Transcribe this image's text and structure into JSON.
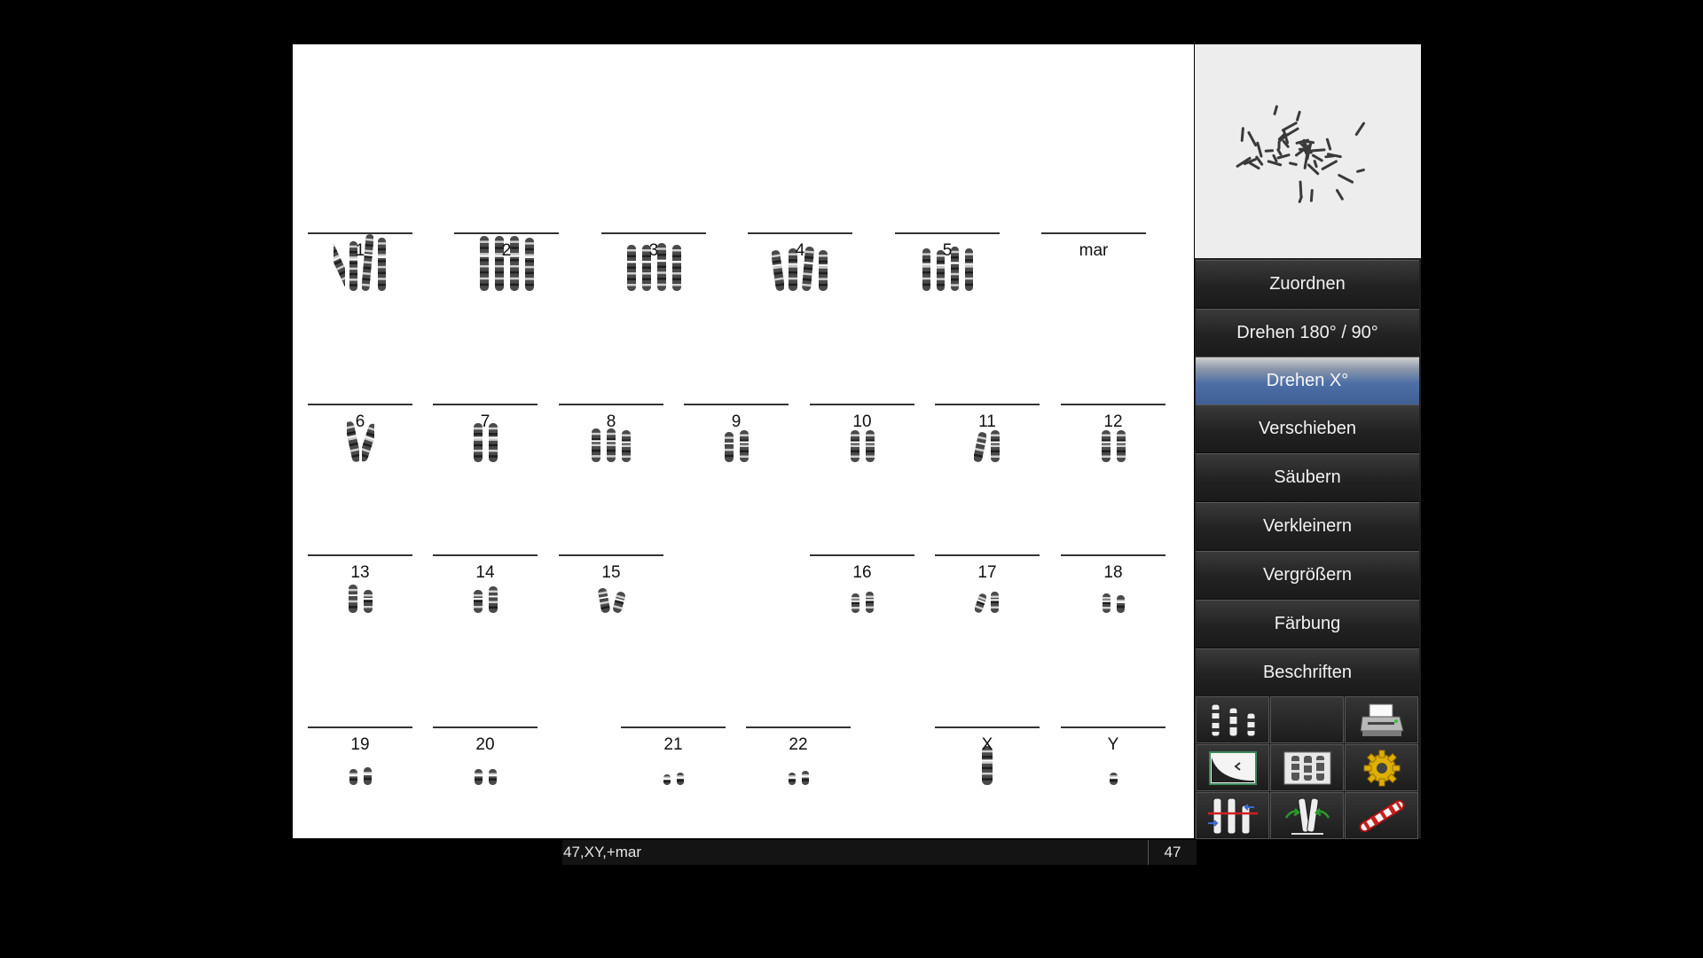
{
  "karyogram": {
    "chromosome_labels": [
      "1",
      "2",
      "3",
      "4",
      "5",
      "mar",
      "6",
      "7",
      "8",
      "9",
      "10",
      "11",
      "12",
      "13",
      "14",
      "15",
      "16",
      "17",
      "18",
      "19",
      "20",
      "21",
      "22",
      "X",
      "Y"
    ]
  },
  "status": {
    "karyotype": "47,XY,+mar",
    "chromosome_count": "47"
  },
  "menu": {
    "assign": "Zuordnen",
    "rotate_180_90": "Drehen 180° / 90°",
    "rotate_x": "Drehen X°",
    "move": "Verschieben",
    "clean": "Säubern",
    "shrink": "Verkleinern",
    "enlarge": "Vergrößern",
    "staining": "Färbung",
    "label": "Beschriften"
  },
  "toolbar": {
    "icons": [
      "karyotype-layout-icon",
      "empty-slot",
      "printer-icon",
      "image-contrast-icon",
      "chromosome-pair-icon",
      "settings-gear-icon",
      "chromosome-swap-icon",
      "chromosome-straighten-icon",
      "chromosome-brush-icon"
    ]
  },
  "colors": {
    "background": "#000000",
    "karyogram_bg": "#ffffff",
    "panel_bg": "#202020",
    "active_button": "#4d6fa5",
    "metaphase_bg": "#ededed"
  }
}
